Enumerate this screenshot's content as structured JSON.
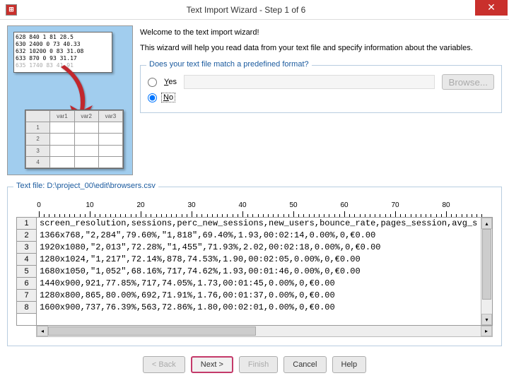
{
  "title": "Text Import Wizard - Step 1 of 6",
  "close_icon": "✕",
  "app_icon": "⊞",
  "intro": {
    "welcome": "Welcome to the text import wizard!",
    "desc": "This wizard will help you read data from your text file and specify information about the variables."
  },
  "illustration": {
    "lines": [
      "628 840 1 81 28.5",
      "630 2400 0 73 40.33",
      "632 10200 0 83 31.08",
      "633 870 0 93 31.17",
      "635 1740       83 41.91"
    ],
    "headers": [
      "",
      "var1",
      "var2",
      "var3"
    ],
    "rownums": [
      "1",
      "2",
      "3",
      "4"
    ]
  },
  "format_group": {
    "legend": "Does your text file match a predefined format?",
    "yes_label": "Yes",
    "no_label": "No",
    "browse_label": "Browse...",
    "selected": "no"
  },
  "file_group": {
    "legend_prefix": "Text file: ",
    "path": "D:\\project_00\\edit\\browsers.csv",
    "ruler_ticks": [
      0,
      10,
      20,
      30,
      40,
      50,
      60,
      70,
      80
    ]
  },
  "preview": {
    "rownums": [
      "1",
      "2",
      "3",
      "4",
      "5",
      "6",
      "7",
      "8"
    ],
    "lines": [
      "screen_resolution,sessions,perc_new_sessions,new_users,bounce_rate,pages_session,avg_s",
      "1366x768,\"2,284\",79.60%,\"1,818\",69.40%,1.93,00:02:14,0.00%,0,€0.00",
      "1920x1080,\"2,013\",72.28%,\"1,455\",71.93%,2.02,00:02:18,0.00%,0,€0.00",
      "1280x1024,\"1,217\",72.14%,878,74.53%,1.90,00:02:05,0.00%,0,€0.00",
      "1680x1050,\"1,052\",68.16%,717,74.62%,1.93,00:01:46,0.00%,0,€0.00",
      "1440x900,921,77.85%,717,74.05%,1.73,00:01:45,0.00%,0,€0.00",
      "1280x800,865,80.00%,692,71.91%,1.76,00:01:37,0.00%,0,€0.00",
      "1600x900,737,76.39%,563,72.86%,1.80,00:02:01,0.00%,0,€0.00"
    ]
  },
  "buttons": {
    "back": "< Back",
    "next": "Next >",
    "finish": "Finish",
    "cancel": "Cancel",
    "help": "Help"
  }
}
